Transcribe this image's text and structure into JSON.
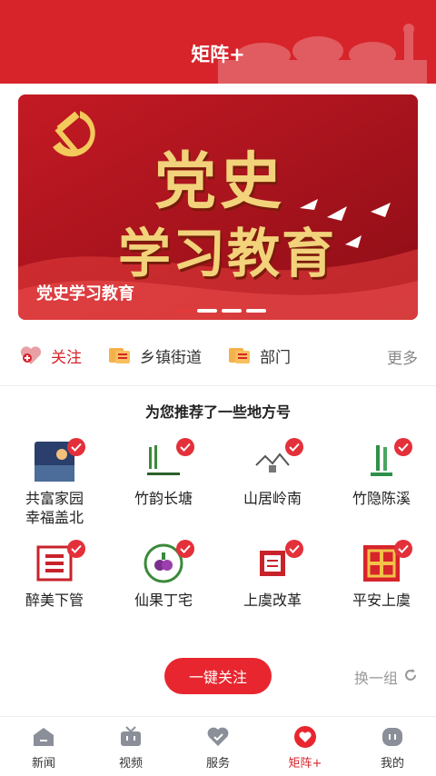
{
  "header": {
    "title": "矩阵+"
  },
  "banner": {
    "headline_line1": "党史",
    "headline_line2": "学习教育",
    "caption": "党史学习教育",
    "dots": 4,
    "active_dot": 0
  },
  "filters": {
    "items": [
      {
        "label": "关注",
        "icon": "heart-plus-icon",
        "active": true
      },
      {
        "label": "乡镇街道",
        "icon": "newspaper-icon",
        "active": false
      },
      {
        "label": "部门",
        "icon": "newspaper-icon",
        "active": false
      }
    ],
    "more_label": "更多"
  },
  "recommend": {
    "title": "为您推荐了一些地方号",
    "accounts": [
      {
        "name": "共富家园\n幸福盖北",
        "checked": true
      },
      {
        "name": "竹韵长塘",
        "checked": true
      },
      {
        "name": "山居岭南",
        "checked": true
      },
      {
        "name": "竹隐陈溪",
        "checked": true
      },
      {
        "name": "醉美下管",
        "checked": true
      },
      {
        "name": "仙果丁宅",
        "checked": true
      },
      {
        "name": "上虞改革",
        "checked": true
      },
      {
        "name": "平安上虞",
        "checked": true
      }
    ],
    "follow_all_label": "一键关注",
    "refresh_label": "换一组"
  },
  "tabbar": {
    "items": [
      {
        "label": "新闻",
        "icon": "home-icon"
      },
      {
        "label": "视频",
        "icon": "tv-icon"
      },
      {
        "label": "服务",
        "icon": "heart-icon"
      },
      {
        "label": "矩阵+",
        "icon": "matrix-heart-icon"
      },
      {
        "label": "我的",
        "icon": "profile-icon"
      }
    ],
    "active_index": 3
  },
  "colors": {
    "brand_red": "#d7242b",
    "gold": "#f2d27a"
  }
}
